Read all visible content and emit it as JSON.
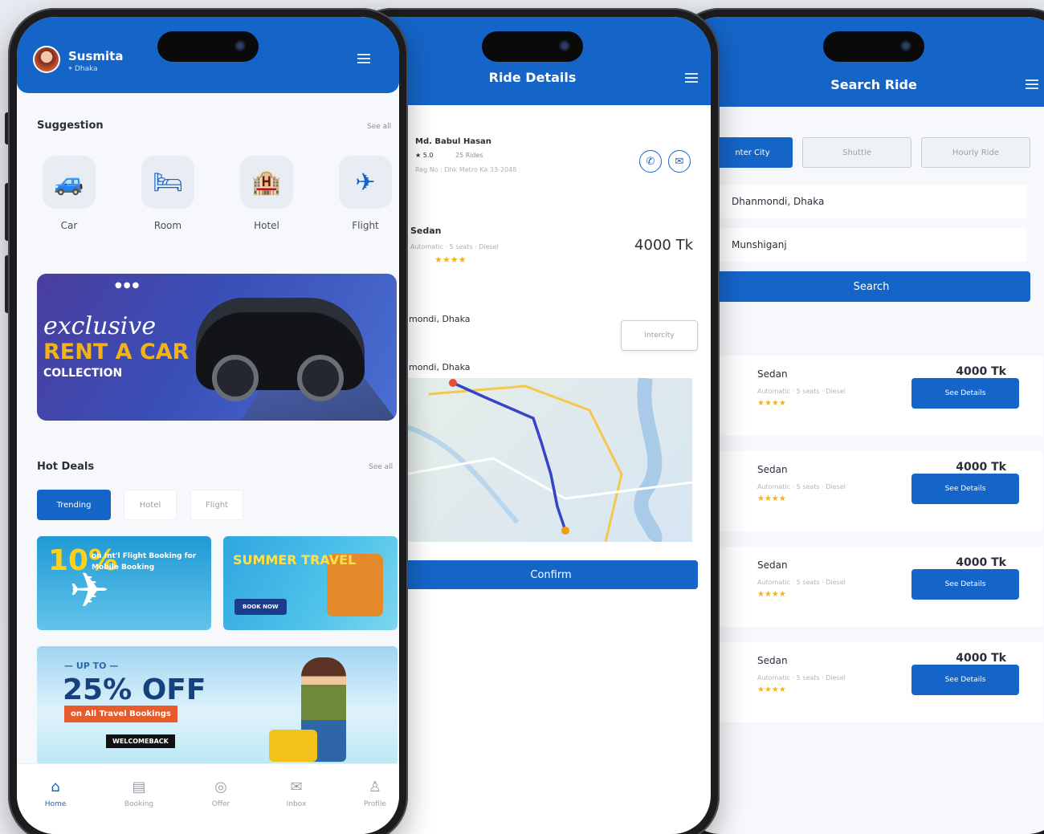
{
  "colors": {
    "primary": "#1565c8",
    "accent": "#f2b21a",
    "background": "#f7f8fb"
  },
  "home": {
    "user_name": "Susmita",
    "user_location": "Dhaka",
    "suggestion_title": "Suggestion",
    "see_all": "See all",
    "categories": [
      {
        "label": "Car",
        "icon": "car-icon",
        "glyph": "🚙"
      },
      {
        "label": "Room",
        "icon": "bed-icon",
        "glyph": "🛏"
      },
      {
        "label": "Hotel",
        "icon": "hotel-icon",
        "glyph": "🏨"
      },
      {
        "label": "Flight",
        "icon": "airplane-icon",
        "glyph": "✈"
      }
    ],
    "banner": {
      "line1": "exclusive",
      "line2": "RENT A CAR",
      "line3": "COLLECTION",
      "dots": "●●●"
    },
    "hot_deals_title": "Hot Deals",
    "hot_deals_see_all": "See all",
    "deal_tabs": [
      "Trending",
      "Hotel",
      "Flight"
    ],
    "deal1": {
      "big": "10%",
      "text": "on Int'l Flight Booking for Mobile Booking"
    },
    "deal2": {
      "title": "SUMMER TRAVEL",
      "button": "BOOK NOW"
    },
    "deal3": {
      "upto": "— UP TO —",
      "percent": "25% OFF",
      "sub": "on All Travel Bookings",
      "code": "WELCOMEBACK"
    },
    "nav": [
      {
        "label": "Home",
        "icon": "home-icon",
        "glyph": "⌂"
      },
      {
        "label": "Booking",
        "icon": "booking-icon",
        "glyph": "▤"
      },
      {
        "label": "Offer",
        "icon": "offer-icon",
        "glyph": "◎"
      },
      {
        "label": "Inbox",
        "icon": "inbox-icon",
        "glyph": "✉"
      },
      {
        "label": "Profile",
        "icon": "profile-icon",
        "glyph": "♙"
      }
    ]
  },
  "ride_details": {
    "title": "Ride Details",
    "driver_name": "Md. Babul Hasan",
    "rating": "★ 5.0",
    "rides": "25 Rides",
    "reg_no": "Reg No : Dhk Metro Ka 33-2048",
    "vehicle": "Sedan",
    "vehicle_meta": "Automatic · 5 seats · Diesel",
    "stars": "★★★★",
    "price": "4000 Tk",
    "pickup": "mondi, Dhaka",
    "dropoff": "mondi, Dhaka",
    "interstop_button": "Intercity",
    "confirm": "Confirm"
  },
  "search_ride": {
    "title": "Search Ride",
    "segments": [
      "nter City",
      "Shuttle",
      "Hourly Ride"
    ],
    "from": "Dhanmondi, Dhaka",
    "to": "Munshiganj",
    "search_button": "Search",
    "results": [
      {
        "name": "Sedan",
        "meta": "Automatic · 5 seats · Diesel",
        "stars": "★★★★",
        "price": "4000 Tk",
        "button": "See Details"
      },
      {
        "name": "Sedan",
        "meta": "Automatic · 5 seats · Diesel",
        "stars": "★★★★",
        "price": "4000 Tk",
        "button": "See Details"
      },
      {
        "name": "Sedan",
        "meta": "Automatic · 5 seats · Diesel",
        "stars": "★★★★",
        "price": "4000 Tk",
        "button": "See Details"
      },
      {
        "name": "Sedan",
        "meta": "Automatic · 5 seats · Diesel",
        "stars": "★★★★",
        "price": "4000 Tk",
        "button": "See Details"
      }
    ]
  }
}
